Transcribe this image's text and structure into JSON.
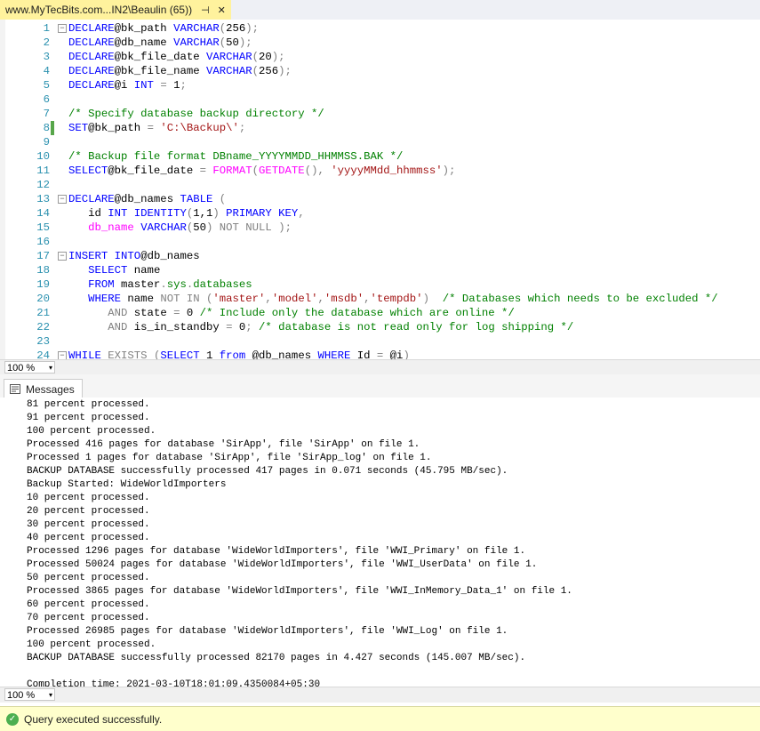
{
  "tab": {
    "title": "www.MyTecBits.com...IN2\\Beaulin (65))",
    "pin": "⊣",
    "close": "✕"
  },
  "editor": {
    "lines": [
      {
        "n": "1",
        "fold": "−",
        "parts": [
          [
            "kw",
            "DECLARE"
          ],
          [
            "",
            "@bk_path "
          ],
          [
            "kw",
            "VARCHAR"
          ],
          [
            "gr",
            "("
          ],
          [
            "",
            "256"
          ],
          [
            "gr",
            ");"
          ]
        ]
      },
      {
        "n": "2",
        "parts": [
          [
            "kw",
            "DECLARE"
          ],
          [
            "",
            "@db_name "
          ],
          [
            "kw",
            "VARCHAR"
          ],
          [
            "gr",
            "("
          ],
          [
            "",
            "50"
          ],
          [
            "gr",
            ");"
          ]
        ]
      },
      {
        "n": "3",
        "parts": [
          [
            "kw",
            "DECLARE"
          ],
          [
            "",
            "@bk_file_date "
          ],
          [
            "kw",
            "VARCHAR"
          ],
          [
            "gr",
            "("
          ],
          [
            "",
            "20"
          ],
          [
            "gr",
            ");"
          ]
        ]
      },
      {
        "n": "4",
        "parts": [
          [
            "kw",
            "DECLARE"
          ],
          [
            "",
            "@bk_file_name "
          ],
          [
            "kw",
            "VARCHAR"
          ],
          [
            "gr",
            "("
          ],
          [
            "",
            "256"
          ],
          [
            "gr",
            ");"
          ]
        ]
      },
      {
        "n": "5",
        "parts": [
          [
            "kw",
            "DECLARE"
          ],
          [
            "",
            "@i "
          ],
          [
            "kw",
            "INT"
          ],
          [
            "gr",
            " = "
          ],
          [
            "",
            "1"
          ],
          [
            "gr",
            ";"
          ]
        ]
      },
      {
        "n": "6",
        "parts": []
      },
      {
        "n": "7",
        "parts": [
          [
            "cm",
            "/* Specify database backup directory */"
          ]
        ]
      },
      {
        "n": "8",
        "changed": true,
        "parts": [
          [
            "kw",
            "SET"
          ],
          [
            "",
            "@bk_path "
          ],
          [
            "gr",
            "= "
          ],
          [
            "st",
            "'C:\\Backup\\'"
          ],
          [
            "gr",
            ";"
          ]
        ]
      },
      {
        "n": "9",
        "parts": []
      },
      {
        "n": "10",
        "parts": [
          [
            "cm",
            "/* Backup file format DBname_YYYYMMDD_HHMMSS.BAK */"
          ]
        ]
      },
      {
        "n": "11",
        "parts": [
          [
            "kw",
            "SELECT"
          ],
          [
            "",
            "@bk_file_date "
          ],
          [
            "gr",
            "= "
          ],
          [
            "fn",
            "FORMAT"
          ],
          [
            "gr",
            "("
          ],
          [
            "fn",
            "GETDATE"
          ],
          [
            "gr",
            "(), "
          ],
          [
            "st",
            "'yyyyMMdd_hhmmss'"
          ],
          [
            "gr",
            ");"
          ]
        ]
      },
      {
        "n": "12",
        "parts": []
      },
      {
        "n": "13",
        "fold": "−",
        "parts": [
          [
            "kw",
            "DECLARE"
          ],
          [
            "",
            "@db_names "
          ],
          [
            "kw",
            "TABLE"
          ],
          [
            "gr",
            " ("
          ]
        ]
      },
      {
        "n": "14",
        "parts": [
          [
            "",
            "   id "
          ],
          [
            "kw",
            "INT IDENTITY"
          ],
          [
            "gr",
            "("
          ],
          [
            "",
            "1,1"
          ],
          [
            "gr",
            ") "
          ],
          [
            "kw",
            "PRIMARY KEY"
          ],
          [
            "gr",
            ","
          ]
        ]
      },
      {
        "n": "15",
        "parts": [
          [
            "fn",
            "   db_name "
          ],
          [
            "kw",
            "VARCHAR"
          ],
          [
            "gr",
            "("
          ],
          [
            "",
            "50"
          ],
          [
            "gr",
            ") "
          ],
          [
            "gr",
            "NOT NULL"
          ],
          [
            "gr",
            " );"
          ]
        ]
      },
      {
        "n": "16",
        "parts": []
      },
      {
        "n": "17",
        "fold": "−",
        "parts": [
          [
            "kw",
            "INSERT INTO"
          ],
          [
            "",
            "@db_names"
          ]
        ]
      },
      {
        "n": "18",
        "parts": [
          [
            "kw",
            "   SELECT"
          ],
          [
            "",
            " name"
          ]
        ]
      },
      {
        "n": "19",
        "parts": [
          [
            "kw",
            "   FROM"
          ],
          [
            "",
            " master"
          ],
          [
            "gr",
            "."
          ],
          [
            "sy",
            "sys"
          ],
          [
            "gr",
            "."
          ],
          [
            "sy",
            "databases"
          ]
        ]
      },
      {
        "n": "20",
        "parts": [
          [
            "kw",
            "   WHERE"
          ],
          [
            "",
            " name "
          ],
          [
            "gr",
            "NOT IN ("
          ],
          [
            "st",
            "'master'"
          ],
          [
            "gr",
            ","
          ],
          [
            "st",
            "'model'"
          ],
          [
            "gr",
            ","
          ],
          [
            "st",
            "'msdb'"
          ],
          [
            "gr",
            ","
          ],
          [
            "st",
            "'tempdb'"
          ],
          [
            "gr",
            ")  "
          ],
          [
            "cm",
            "/* Databases which needs to be excluded */"
          ]
        ]
      },
      {
        "n": "21",
        "parts": [
          [
            "gr",
            "      AND"
          ],
          [
            "",
            " state "
          ],
          [
            "gr",
            "= "
          ],
          [
            "",
            "0 "
          ],
          [
            "cm",
            "/* Include only the database which are online */"
          ]
        ]
      },
      {
        "n": "22",
        "parts": [
          [
            "gr",
            "      AND"
          ],
          [
            "",
            " is_in_standby "
          ],
          [
            "gr",
            "= "
          ],
          [
            "",
            "0"
          ],
          [
            "gr",
            "; "
          ],
          [
            "cm",
            "/* database is not read only for log shipping */"
          ]
        ]
      },
      {
        "n": "23",
        "parts": []
      },
      {
        "n": "24",
        "fold": "−",
        "parts": [
          [
            "kw",
            "WHILE"
          ],
          [
            "gr",
            " EXISTS ("
          ],
          [
            "kw",
            "SELECT"
          ],
          [
            "",
            " 1 "
          ],
          [
            "kw",
            "from"
          ],
          [
            "",
            " @db_names "
          ],
          [
            "kw",
            "WHERE"
          ],
          [
            "",
            " Id "
          ],
          [
            "gr",
            "= "
          ],
          [
            "",
            "@i"
          ],
          [
            "gr",
            ")"
          ]
        ]
      }
    ]
  },
  "zoom_top": {
    "value": "100 %",
    "arrow": "▾"
  },
  "messages_tab": {
    "label": "Messages"
  },
  "messages": [
    "81 percent processed.",
    "91 percent processed.",
    "100 percent processed.",
    "Processed 416 pages for database 'SirApp', file 'SirApp' on file 1.",
    "Processed 1 pages for database 'SirApp', file 'SirApp_log' on file 1.",
    "BACKUP DATABASE successfully processed 417 pages in 0.071 seconds (45.795 MB/sec).",
    "Backup Started: WideWorldImporters",
    "10 percent processed.",
    "20 percent processed.",
    "30 percent processed.",
    "40 percent processed.",
    "Processed 1296 pages for database 'WideWorldImporters', file 'WWI_Primary' on file 1.",
    "Processed 50024 pages for database 'WideWorldImporters', file 'WWI_UserData' on file 1.",
    "50 percent processed.",
    "Processed 3865 pages for database 'WideWorldImporters', file 'WWI_InMemory_Data_1' on file 1.",
    "60 percent processed.",
    "70 percent processed.",
    "Processed 26985 pages for database 'WideWorldImporters', file 'WWI_Log' on file 1.",
    "100 percent processed.",
    "BACKUP DATABASE successfully processed 82170 pages in 4.427 seconds (145.007 MB/sec).",
    "",
    "Completion time: 2021-03-10T18:01:09.4350084+05:30"
  ],
  "zoom_bottom": {
    "value": "100 %",
    "arrow": "▾"
  },
  "status": {
    "text": "Query executed successfully.",
    "icon": "check-circle-icon"
  }
}
